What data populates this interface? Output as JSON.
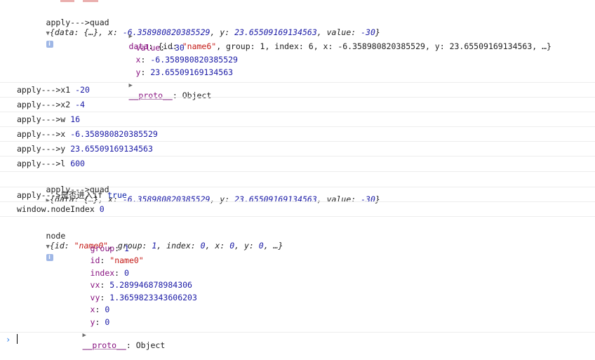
{
  "entries": {
    "quad1": {
      "label": "apply--->quad",
      "summary_open": "{data: {…}, x: ",
      "summary_x": "-6.358980820385529",
      "summary_mid": ", y: ",
      "summary_y": "23.65509169134563",
      "summary_mid2": ", value: ",
      "summary_value": "-30",
      "summary_close": "}",
      "data_key": "data",
      "data_open": ": {id: ",
      "data_id": "\"name6\"",
      "data_mid1": ", group: ",
      "data_group": "1",
      "data_mid2": ", index: ",
      "data_index": "6",
      "data_mid3": ", x: ",
      "data_x": "-6.358980820385529",
      "data_mid4": ", y: ",
      "data_y": "23.65509169134563",
      "data_tail": ", …}",
      "value_key": "value",
      "value": "-30",
      "x_key": "x",
      "x": "-6.358980820385529",
      "y_key": "y",
      "y": "23.65509169134563",
      "proto_key": "__proto__",
      "proto_value": "Object"
    },
    "x1": {
      "label": "apply--->x1",
      "value": "-20"
    },
    "x2": {
      "label": "apply--->x2",
      "value": "-4"
    },
    "w": {
      "label": "apply--->w",
      "value": "16"
    },
    "x": {
      "label": "apply--->x",
      "value": "-6.358980820385529"
    },
    "y": {
      "label": "apply--->y",
      "value": "23.65509169134563"
    },
    "l": {
      "label": "apply--->l",
      "value": "600"
    },
    "quad2": {
      "label": "apply--->quad",
      "summary_open": "{data: {…}, x: ",
      "summary_x": "-6.358980820385529",
      "summary_mid": ", y: ",
      "summary_y": "23.65509169134563",
      "summary_mid2": ", value: ",
      "summary_value": "-30",
      "summary_close": "}"
    },
    "if": {
      "label": "apply--->是否进入if",
      "value": "true"
    },
    "nodeIndex": {
      "label": "window.nodeIndex",
      "value": "0"
    },
    "node": {
      "label": "node",
      "summary_open": "{id: ",
      "summary_id": "\"name0\"",
      "summary_mid1": ", group: ",
      "summary_group": "1",
      "summary_mid2": ", index: ",
      "summary_index": "0",
      "summary_mid3": ", x: ",
      "summary_x": "0",
      "summary_mid4": ", y: ",
      "summary_y": "0",
      "summary_tail": ", …}",
      "group_key": "group",
      "group": "1",
      "id_key": "id",
      "id": "\"name0\"",
      "index_key": "index",
      "index": "0",
      "vx_key": "vx",
      "vx": "5.289946878984306",
      "vy_key": "vy",
      "vy": "1.3659823343606203",
      "x_key": "x",
      "x": "0",
      "y_key": "y",
      "y": "0",
      "proto_key": "__proto__",
      "proto_value": "Object"
    }
  },
  "icons": {
    "expanded": "▼",
    "collapsed": "▶",
    "info": "i",
    "prompt": "›"
  },
  "colors": {
    "property_key": "#881280",
    "number": "#1a1aa6",
    "string": "#c41a16",
    "keyword": "#0d22aa",
    "prompt": "#2b7de9"
  }
}
